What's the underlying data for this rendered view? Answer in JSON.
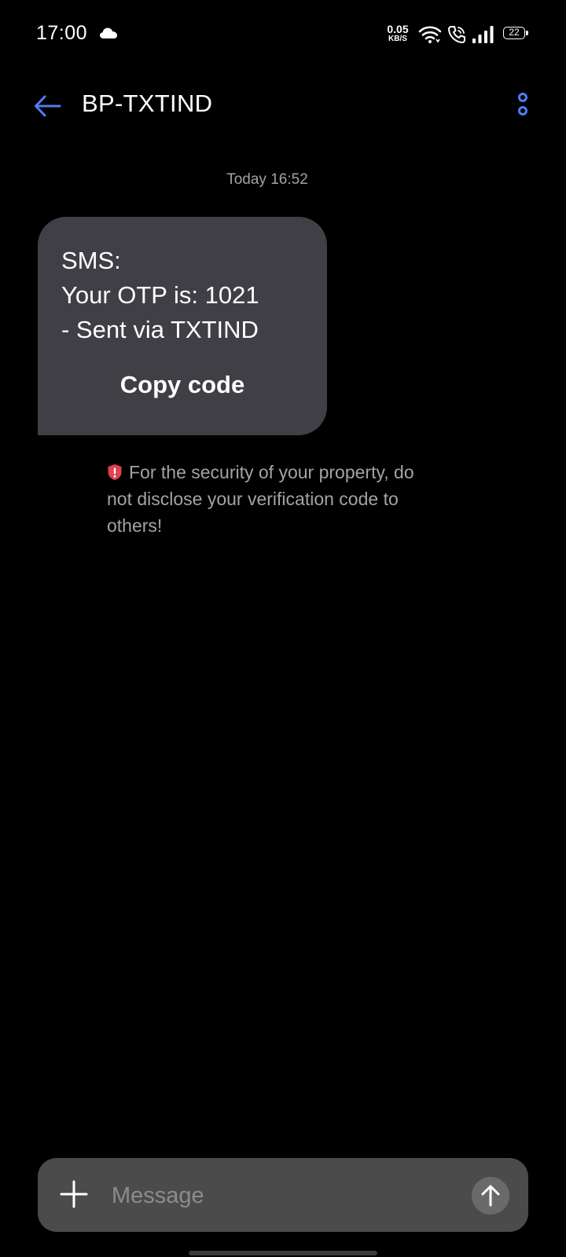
{
  "status_bar": {
    "time": "17:00",
    "cloud_icon": "cloud-icon",
    "net_speed_value": "0.05",
    "net_speed_unit": "KB/S",
    "wifi_icon": "wifi-icon",
    "call_icon": "wifi-call-icon",
    "signal_icon": "signal-icon",
    "battery_level": "22"
  },
  "header": {
    "back_icon": "arrow-left-icon",
    "title": "BP-TXTIND",
    "more_icon": "more-vertical-icon"
  },
  "conversation": {
    "timestamp": "Today 16:52",
    "message": {
      "text": "SMS:\nYour OTP is: 1021\n- Sent via TXTIND",
      "copy_label": "Copy code"
    },
    "security_note": "For the security of your property, do not disclose your verification code to others!",
    "security_icon": "shield-alert-icon"
  },
  "composer": {
    "add_icon": "plus-icon",
    "placeholder": "Message",
    "value": "",
    "send_icon": "arrow-up-icon"
  },
  "colors": {
    "background": "#000000",
    "accent": "#4f7df0",
    "bubble": "#3f3f45",
    "composer": "#4b4b4b",
    "secondary_text": "#a3a3a3",
    "warning": "#e0424f"
  }
}
